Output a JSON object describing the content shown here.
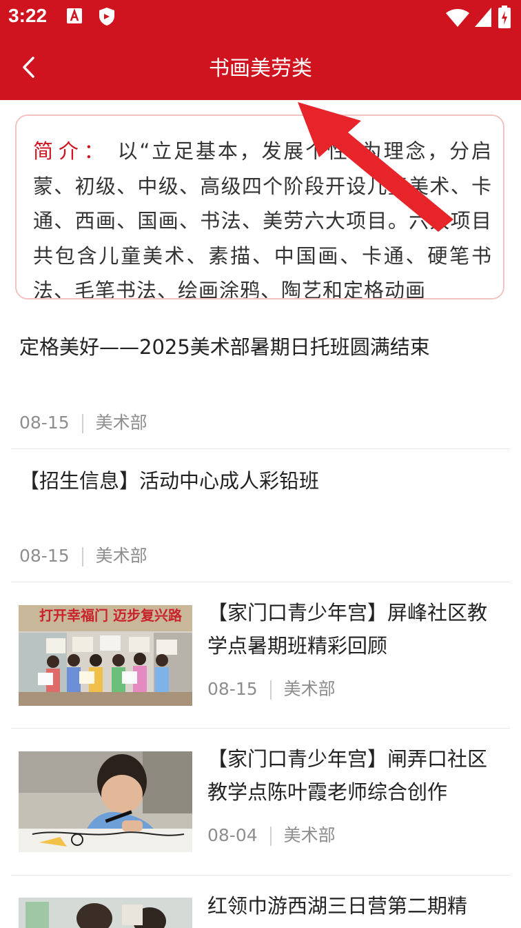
{
  "status_bar": {
    "time": "3:22"
  },
  "header": {
    "title": "书画美劳类"
  },
  "intro": {
    "label": "简介：",
    "text": "以“立足基本，发展个性”为理念，分启蒙、初级、中级、高级四个阶段开设儿童美术、卡通、西画、国画、书法、美劳六大项目。六大项目共包含儿童美术、素描、中国画、卡通、硬笔书法、毛笔书法、绘画涂鸦、陶艺和定格动画"
  },
  "news": [
    {
      "title": "定格美好——2025美术部暑期日托班圆满结束",
      "date": "08-15",
      "dept": "美术部"
    },
    {
      "title": "【招生信息】活动中心成人彩铅班",
      "date": "08-15",
      "dept": "美术部"
    },
    {
      "title": "【家门口青少年宫】屏峰社区教学点暑期班精彩回顾",
      "date": "08-15",
      "dept": "美术部",
      "image": "children-with-paintings-photo",
      "banner_text": "打开幸福门 迈步复兴路"
    },
    {
      "title": "【家门口青少年宫】闸弄口社区教学点陈叶霞老师综合创作",
      "date": "08-04",
      "dept": "美术部",
      "image": "boy-drawing-photo"
    },
    {
      "title": "红领巾游西湖三日营第二期精",
      "image": "classroom-photo"
    }
  ],
  "colors": {
    "brand": "#cf141f",
    "annotation_arrow": "#e8242b"
  }
}
